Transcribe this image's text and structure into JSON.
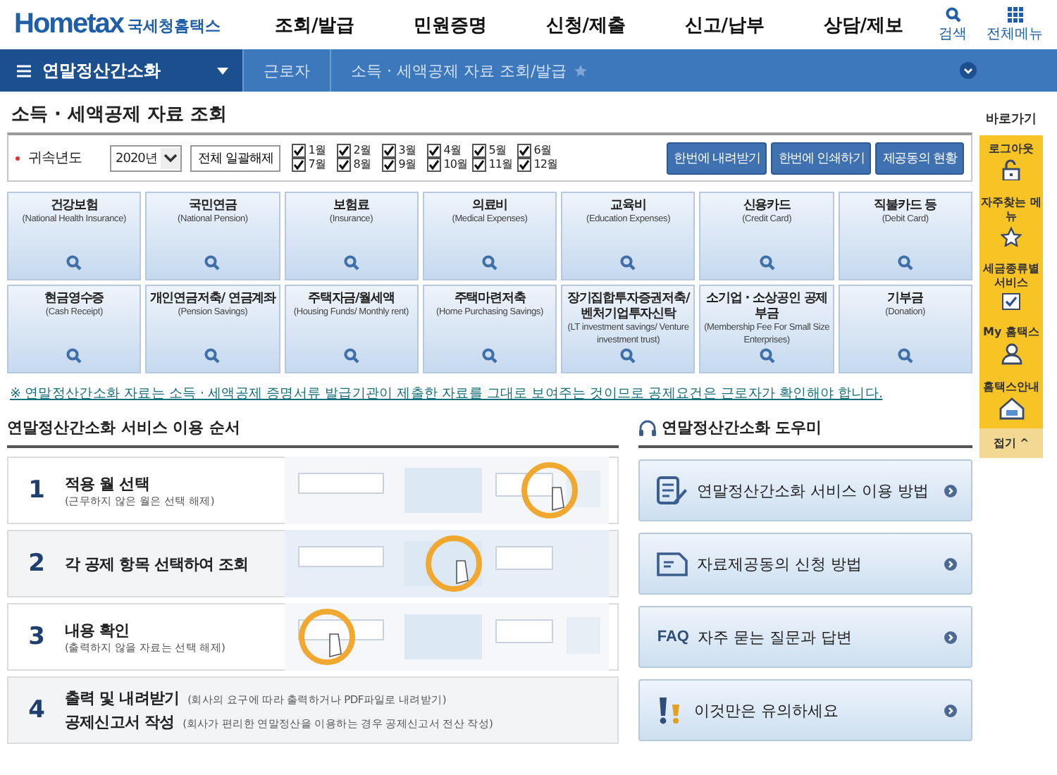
{
  "header": {
    "logo_text": "Hometax",
    "logo_suffix": "국세청홈택스",
    "nav": [
      "조회/발급",
      "민원증명",
      "신청/제출",
      "신고/납부",
      "상담/제보"
    ],
    "tools": [
      {
        "kind": "search",
        "label": "검색"
      },
      {
        "kind": "grid",
        "label": "전체메뉴"
      }
    ]
  },
  "breadcrumb": {
    "menu": "연말정산간소화",
    "items": [
      "근로자",
      "소득 · 세액공제 자료 조회/발급"
    ]
  },
  "page_title": "소득 · 세액공제 자료 조회",
  "filter": {
    "label": "귀속년도",
    "year": "2020년",
    "clear_button": "전체 일괄해제",
    "months": [
      {
        "label": "1월",
        "checked": true
      },
      {
        "label": "2월",
        "checked": true
      },
      {
        "label": "3월",
        "checked": true
      },
      {
        "label": "4월",
        "checked": true
      },
      {
        "label": "5월",
        "checked": true
      },
      {
        "label": "6월",
        "checked": true
      },
      {
        "label": "7월",
        "checked": true
      },
      {
        "label": "8월",
        "checked": true
      },
      {
        "label": "9월",
        "checked": true
      },
      {
        "label": "10월",
        "checked": true
      },
      {
        "label": "11월",
        "checked": true
      },
      {
        "label": "12월",
        "checked": true
      }
    ],
    "buttons": [
      "한번에 내려받기",
      "한번에 인쇄하기",
      "제공동의 현황"
    ]
  },
  "tiles": [
    {
      "title": "건강보험",
      "subtitle": "(National Health Insurance)"
    },
    {
      "title": "국민연금",
      "subtitle": "(National Pension)"
    },
    {
      "title": "보험료",
      "subtitle": "(Insurance)"
    },
    {
      "title": "의료비",
      "subtitle": "(Medical Expenses)"
    },
    {
      "title": "교육비",
      "subtitle": "(Education Expenses)"
    },
    {
      "title": "신용카드",
      "subtitle": "(Credit Card)"
    },
    {
      "title": "직불카드 등",
      "subtitle": "(Debit Card)"
    },
    {
      "title": "현금영수증",
      "subtitle": "(Cash Receipt)"
    },
    {
      "title": "개인연금저축/ 연금계좌",
      "subtitle": "(Pension Savings)"
    },
    {
      "title": "주택자금/월세액",
      "subtitle": "(Housing Funds/ Monthly rent)"
    },
    {
      "title": "주택마련저축",
      "subtitle": "(Home Purchasing Savings)"
    },
    {
      "title": "장기집합투자증권저축/ 벤처기업투자신탁",
      "subtitle": "(LT investment savings/ Venture investment trust)"
    },
    {
      "title": "소기업 · 소상공인 공제부금",
      "subtitle": "(Membership Fee For Small Size Enterprises)"
    },
    {
      "title": "기부금",
      "subtitle": "(Donation)"
    }
  ],
  "notice": "※ 연말정산간소화 자료는 소득 · 세액공제 증명서류 발급기관이 제출한 자료를 그대로 보여주는 것이므로 공제요건은 근로자가 확인해야 합니다.",
  "steps_section": {
    "title": "연말정산간소화 서비스 이용 순서",
    "steps": [
      {
        "number": "1",
        "lines": [
          {
            "title": "적용 월 선택",
            "desc": "(근무하지 않은 월은 선택 해제)"
          }
        ],
        "illustration": {
          "kind": "picture"
        }
      },
      {
        "number": "2",
        "lines": [
          {
            "title": "각 공제 항목 선택하여 조회"
          }
        ],
        "illustration": {
          "kind": "picture"
        }
      },
      {
        "number": "3",
        "lines": [
          {
            "title": "내용 확인",
            "desc": "(출력하지 않을 자료는 선택 해제)"
          }
        ],
        "illustration": {
          "kind": "picture"
        }
      },
      {
        "number": "4",
        "lines": [
          {
            "title": "출력 및 내려받기",
            "desc": "(회사의 요구에 따라 출력하거나 PDF파일로 내려받기)"
          },
          {
            "title": "공제신고서 작성",
            "desc": "(회사가 편리한 연말정산을 이용하는 경우 공제신고서 전산 작성)"
          }
        ]
      }
    ]
  },
  "help_section": {
    "title": "연말정산간소화 도우미",
    "items": [
      {
        "kind": "guide",
        "label": "연말정산간소화 서비스 이용 방법"
      },
      {
        "kind": "form",
        "label": "자료제공동의 신청 방법"
      },
      {
        "kind": "faq",
        "icon_text": "FAQ",
        "label": "자주 묻는 질문과 답변"
      },
      {
        "kind": "warning",
        "label": "이것만은 유의하세요"
      }
    ]
  },
  "quick_menu": {
    "title": "바로가기",
    "items": [
      {
        "kind": "lock",
        "label": "로그아웃"
      },
      {
        "kind": "star",
        "label": "자주찾는 메뉴"
      },
      {
        "kind": "check",
        "label": "세금종류별 서비스"
      },
      {
        "kind": "person",
        "label": "My 홈택스"
      },
      {
        "kind": "house",
        "label": "홈택스안내"
      }
    ],
    "collapse": "접기 ^"
  }
}
